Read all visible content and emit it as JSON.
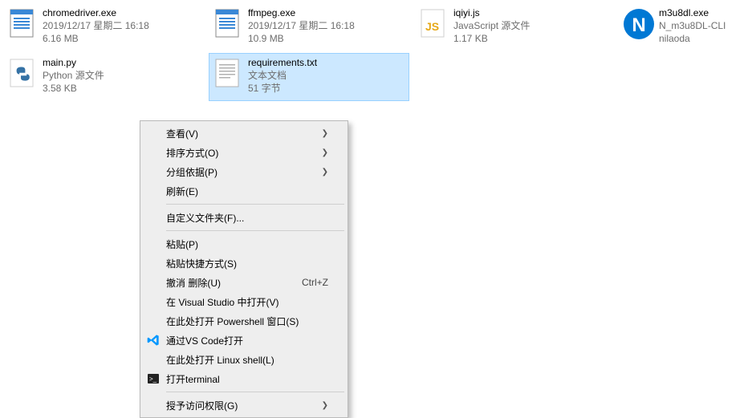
{
  "files": [
    {
      "name": "chromedriver.exe",
      "line2": "2019/12/17 星期二 16:18",
      "line3": "6.16 MB",
      "icon": "exe",
      "selected": false
    },
    {
      "name": "ffmpeg.exe",
      "line2": "2019/12/17 星期二 16:18",
      "line3": "10.9 MB",
      "icon": "exe",
      "selected": false
    },
    {
      "name": "iqiyi.js",
      "line2": "JavaScript 源文件",
      "line3": "1.17 KB",
      "icon": "js",
      "selected": false
    },
    {
      "name": "m3u8dl.exe",
      "line2": "N_m3u8DL-CLI",
      "line3": "nilaoda",
      "icon": "ncircle",
      "selected": false
    },
    {
      "name": "main.py",
      "line2": "Python 源文件",
      "line3": "3.58 KB",
      "icon": "py",
      "selected": false
    },
    {
      "name": "requirements.txt",
      "line2": "文本文档",
      "line3": "51 字节",
      "icon": "txt",
      "selected": true
    }
  ],
  "menu": {
    "view": "查看(V)",
    "sort": "排序方式(O)",
    "group": "分组依据(P)",
    "refresh": "刷新(E)",
    "custom_folder": "自定义文件夹(F)...",
    "paste": "粘贴(P)",
    "paste_shortcut": "粘贴快捷方式(S)",
    "undo_delete": "撤消 删除(U)",
    "undo_delete_shortcut": "Ctrl+Z",
    "open_vs": "在 Visual Studio 中打开(V)",
    "open_ps": "在此处打开 Powershell 窗口(S)",
    "open_vscode": "通过VS Code打开",
    "open_linux": "在此处打开 Linux shell(L)",
    "open_terminal": "打开terminal",
    "give_access": "授予访问权限(G)"
  }
}
